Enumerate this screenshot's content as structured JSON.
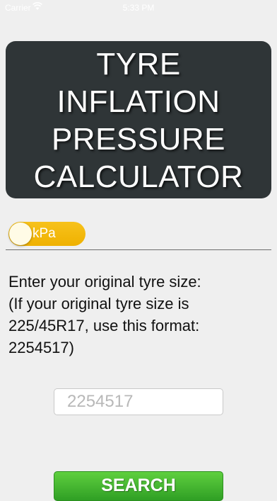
{
  "status_bar": {
    "carrier": "Carrier",
    "time": "5:33 PM",
    "wifi_icon": "wifi-icon"
  },
  "header": {
    "title": "TYRE\nINFLATION\nPRESSURE\nCALCULATOR"
  },
  "unit_toggle": {
    "label": "kPa",
    "color": "#f2b600"
  },
  "instructions": {
    "lines": [
      "Enter your original tyre size:",
      "(If your original tyre size is",
      "225/45R17, use this format:",
      "2254517)"
    ]
  },
  "tyre_size_input": {
    "value": "",
    "placeholder": "2254517"
  },
  "search_button": {
    "label": "SEARCH",
    "color": "#3fae2c"
  },
  "colors": {
    "background": "#efefef",
    "title_card": "#2f3537"
  }
}
